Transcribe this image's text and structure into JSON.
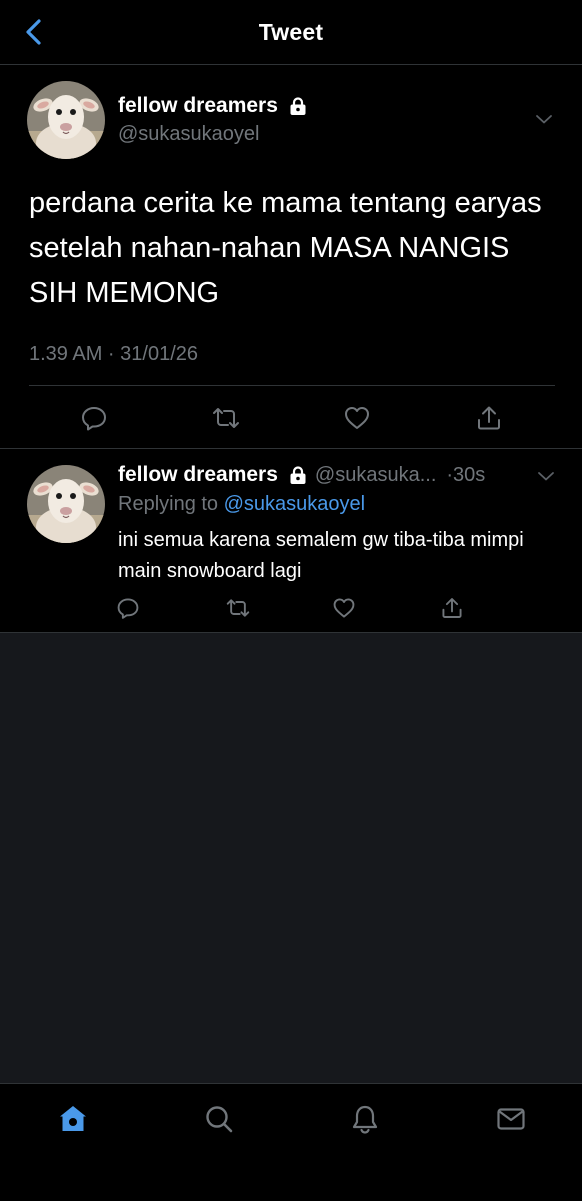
{
  "header": {
    "title": "Tweet",
    "back_icon": "chevron-left-icon"
  },
  "colors": {
    "background": "#000000",
    "empty_background": "#16181c",
    "accent": "#4a99e9",
    "secondary_text": "#71767b",
    "divider": "#2f3336"
  },
  "main_tweet": {
    "display_name": "fellow dreamers",
    "handle": "@sukasukaoyel",
    "text": "perdana cerita ke mama tentang earyas setelah nahan-nahan MASA NANGIS SIH MEMONG",
    "timestamp": "1.39 AM · 31/01/26",
    "protected_icon": "lock-icon",
    "actions": [
      "reply-icon",
      "retweet-icon",
      "like-icon",
      "share-icon"
    ]
  },
  "reply_tweet": {
    "display_name": "fellow dreamers",
    "handle": "@sukasuka...",
    "time": "·30s",
    "replying_to_label": "Replying to",
    "replying_to_handle": "@sukasukaoyel",
    "text": "ini semua karena semalem gw tiba-tiba mimpi main snowboard lagi",
    "actions": [
      "reply-icon",
      "retweet-icon",
      "like-icon",
      "share-icon"
    ]
  },
  "bottom_nav": {
    "items": [
      "home-icon",
      "search-icon",
      "notifications-icon",
      "messages-icon"
    ],
    "active": "home-icon"
  }
}
